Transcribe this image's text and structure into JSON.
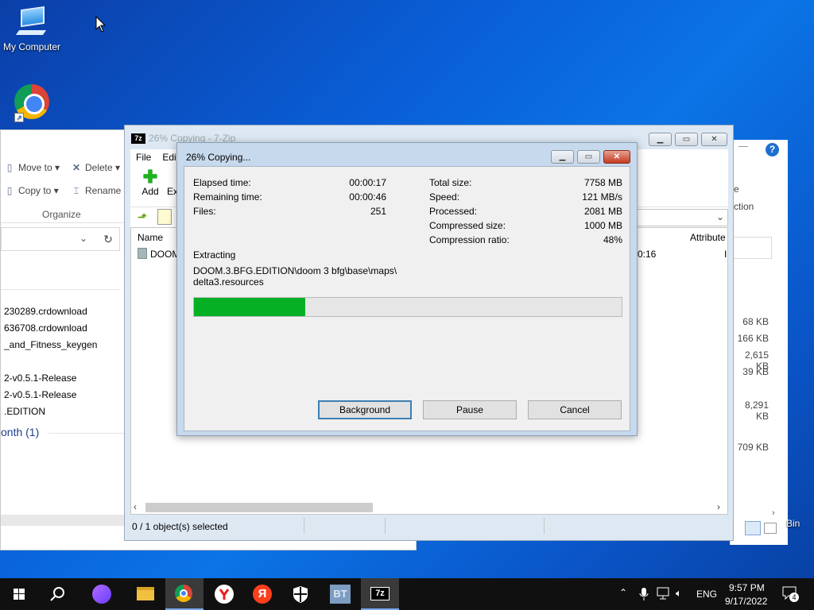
{
  "desktop": {
    "icons": [
      {
        "label": "My Computer",
        "icon": "computer-icon"
      },
      {
        "label": "Google Chrome",
        "icon": "chrome-icon"
      }
    ]
  },
  "explorer": {
    "ribbon": {
      "move_to": "Move to",
      "copy_to": "Copy to",
      "delete": "Delete",
      "rename": "Rename",
      "group": "Organize"
    },
    "files": [
      "230289.crdownload",
      "636708.crdownload",
      "_and_Fitness_keygen",
      "2-v0.5.1-Release",
      "2-v0.5.1-Release",
      ".EDITION"
    ],
    "group_header": "onth (1)"
  },
  "right_window": {
    "help": "?",
    "frag1": "e",
    "frag2": "ction",
    "sizes": [
      "68 KB",
      "166 KB",
      "2,615 KB",
      "39 KB",
      "8,291 KB",
      "709 KB"
    ],
    "bin_label": "Bin"
  },
  "sevenzip": {
    "title": "26% Copying - 7-Zip",
    "logo": "7z",
    "menu": [
      "File",
      "Edit"
    ],
    "toolbar": {
      "add": "Add",
      "extract": "Ex"
    },
    "columns": {
      "name": "Name",
      "attributes": "Attribute"
    },
    "rows": [
      {
        "name": "DOOM",
        "time": "0:16",
        "attr": "I"
      }
    ],
    "status": "0 / 1 object(s) selected"
  },
  "progress": {
    "title": "26% Copying...",
    "left_stats": [
      {
        "label": "Elapsed time:",
        "value": "00:00:17"
      },
      {
        "label": "Remaining time:",
        "value": "00:00:46"
      },
      {
        "label": "Files:",
        "value": "251"
      }
    ],
    "right_stats": [
      {
        "label": "Total size:",
        "value": "7758 MB"
      },
      {
        "label": "Speed:",
        "value": "121 MB/s"
      },
      {
        "label": "Processed:",
        "value": "2081 MB"
      },
      {
        "label": "Compressed size:",
        "value": "1000 MB"
      },
      {
        "label": "Compression ratio:",
        "value": "48%"
      }
    ],
    "operation": "Extracting",
    "path_line1": "DOOM.3.BFG.EDITION\\doom 3 bfg\\base\\maps\\",
    "path_line2": "delta3.resources",
    "percent": 26,
    "buttons": {
      "background": "Background",
      "pause": "Pause",
      "cancel": "Cancel"
    }
  },
  "taskbar": {
    "apps": [
      "start-icon",
      "search-icon",
      "alice-icon",
      "file-explorer-icon",
      "chrome-icon",
      "yandex-browser-icon",
      "yandex-icon",
      "security-icon",
      "bt-icon",
      "7zip-icon"
    ],
    "bt_label": "BT",
    "sevenzip_label": "7z",
    "yandex_label": "Я",
    "lang": "ENG",
    "time": "9:57 PM",
    "date": "9/17/2022",
    "notifications": "4"
  }
}
